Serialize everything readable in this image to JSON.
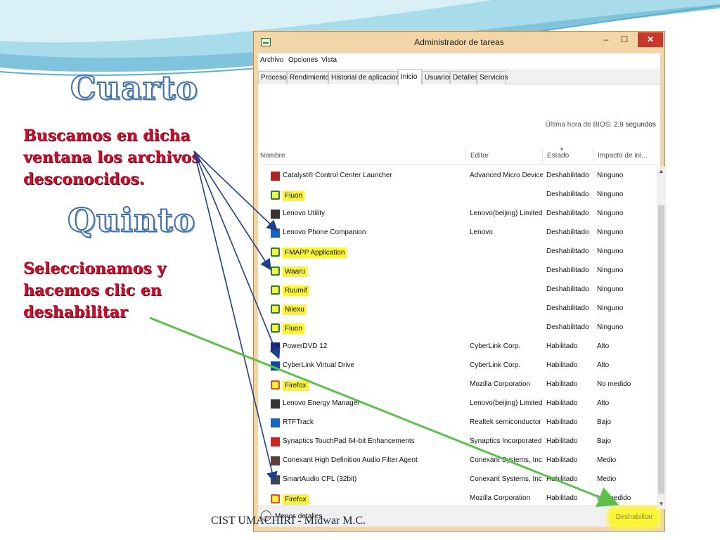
{
  "slide": {
    "heading_1": "Cuarto",
    "text_1": "Buscamos en dicha ventana los archivos desconocidos.",
    "heading_2": "Quinto",
    "text_2": "Seleccionamos y hacemos  clic en deshabilitar",
    "footer": "CIST UMACHIRI - Midwar M.C."
  },
  "window": {
    "title": "Administrador de tareas",
    "controls": {
      "minimize": "–",
      "maximize": "☐",
      "close": "✕"
    }
  },
  "menu": [
    "Archivo",
    "Opciones",
    "Vista"
  ],
  "tabs": [
    "Procesos",
    "Rendimiento",
    "Historial de aplicaciones",
    "Inicio",
    "Usuarios",
    "Detalles",
    "Servicios"
  ],
  "active_tab": "Inicio",
  "bios": {
    "label": "Última hora de BIOS:",
    "value": "2.9 segundos"
  },
  "columns": [
    "Nombre",
    "Editor",
    "Estado",
    "Impacto de ini..."
  ],
  "rows": [
    {
      "name": "Catalyst® Control Center Launcher",
      "editor": "Advanced Micro Device...",
      "estado": "Deshabilitado",
      "impacto": "Ninguno",
      "icon": "catalyst-icon",
      "icon_color": "#b22222",
      "highlight": false
    },
    {
      "name": "Fiuon",
      "editor": "",
      "estado": "Deshabilitado",
      "impacto": "Ninguno",
      "icon": "app-icon",
      "icon_color": "#2e7d32",
      "highlight": true
    },
    {
      "name": "Lenovo Utility",
      "editor": "Lenovo(beijing) Limited",
      "estado": "Deshabilitado",
      "impacto": "Ninguno",
      "icon": "lenovo-utility-icon",
      "icon_color": "#333333",
      "highlight": false
    },
    {
      "name": "Lenovo Phone Companion",
      "editor": "Lenovo",
      "estado": "Deshabilitado",
      "impacto": "Ninguno",
      "icon": "phone-companion-icon",
      "icon_color": "#1565c0",
      "highlight": false
    },
    {
      "name": "FMAPP Application",
      "editor": "",
      "estado": "Deshabilitado",
      "impacto": "Ninguno",
      "icon": "app-icon",
      "icon_color": "#2e7d32",
      "highlight": true
    },
    {
      "name": "Waaru",
      "editor": "",
      "estado": "Deshabilitado",
      "impacto": "Ninguno",
      "icon": "app-icon",
      "icon_color": "#2e7d32",
      "highlight": true
    },
    {
      "name": "Ruumif",
      "editor": "",
      "estado": "Deshabilitado",
      "impacto": "Ninguno",
      "icon": "app-icon",
      "icon_color": "#2e7d32",
      "highlight": true
    },
    {
      "name": "Niiexu",
      "editor": "",
      "estado": "Deshabilitado",
      "impacto": "Ninguno",
      "icon": "app-icon",
      "icon_color": "#2e7d32",
      "highlight": true
    },
    {
      "name": "Fiuon",
      "editor": "",
      "estado": "Deshabilitado",
      "impacto": "Ninguno",
      "icon": "app-icon",
      "icon_color": "#2e7d32",
      "highlight": true
    },
    {
      "name": "PowerDVD 12",
      "editor": "CyberLink Corp.",
      "estado": "Habilitado",
      "impacto": "Alto",
      "icon": "powerdvd-icon",
      "icon_color": "#1a237e",
      "highlight": false
    },
    {
      "name": "CyberLink Virtual Drive",
      "editor": "CyberLink Corp.",
      "estado": "Habilitado",
      "impacto": "Alto",
      "icon": "virtual-drive-icon",
      "icon_color": "#0d47a1",
      "highlight": false
    },
    {
      "name": "Firefox",
      "editor": "Mozilla Corporation",
      "estado": "Habilitado",
      "impacto": "No medido",
      "icon": "firefox-icon",
      "icon_color": "#e65100",
      "highlight": true
    },
    {
      "name": "Lenovo Energy Manager",
      "editor": "Lenovo(beijing) Limited",
      "estado": "Habilitado",
      "impacto": "Alto",
      "icon": "energy-manager-icon",
      "icon_color": "#333333",
      "highlight": false
    },
    {
      "name": "RTFTrack",
      "editor": "Realtek semiconductor",
      "estado": "Habilitado",
      "impacto": "Bajo",
      "icon": "rtftrack-icon",
      "icon_color": "#1565c0",
      "highlight": false
    },
    {
      "name": "Synaptics TouchPad 64-bit Enhancements",
      "editor": "Synaptics Incorporated",
      "estado": "Habilitado",
      "impacto": "Bajo",
      "icon": "synaptics-icon",
      "icon_color": "#c62828",
      "highlight": false
    },
    {
      "name": "Conexant High Definition Audio Filter Agent",
      "editor": "Conexant Systems, Inc.",
      "estado": "Habilitado",
      "impacto": "Medio",
      "icon": "conexant-icon",
      "icon_color": "#5d4037",
      "highlight": false
    },
    {
      "name": "SmartAudio CPL (32bit)",
      "editor": "Conexant Systems, Inc.",
      "estado": "Habilitado",
      "impacto": "Medio",
      "icon": "smartaudio-icon",
      "icon_color": "#424242",
      "highlight": false
    },
    {
      "name": "Firefox",
      "editor": "Mozilla Corporation",
      "estado": "Habilitado",
      "impacto": "No medido",
      "icon": "firefox-icon",
      "icon_color": "#e65100",
      "highlight": true
    }
  ],
  "bottom": {
    "less_details": "Menos detalles",
    "disable_button": "Deshabilitar"
  },
  "colors": {
    "highlight": "#fbf536",
    "heading_outline": "#3f6fa6",
    "instruction_text": "#c8102e",
    "arrow_blue": "#1f3f8a",
    "arrow_green": "#5cc04a"
  }
}
